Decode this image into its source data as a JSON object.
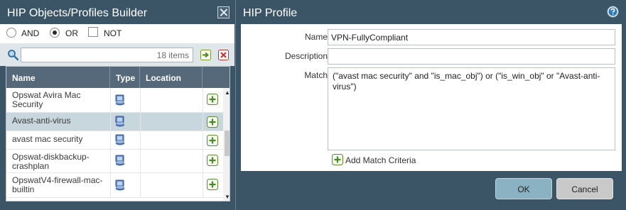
{
  "left_panel": {
    "title": "HIP Objects/Profiles Builder",
    "logic": {
      "and_label": "AND",
      "or_label": "OR",
      "not_label": "NOT",
      "selected": "OR"
    },
    "search": {
      "value": "",
      "count_text": "18 items"
    },
    "columns": [
      "Name",
      "Type",
      "Location"
    ],
    "rows": [
      {
        "name": "Opswat Avira Mac Security",
        "type_icon": "hip-object-icon",
        "location": ""
      },
      {
        "name": "Avast-anti-virus",
        "type_icon": "hip-object-icon",
        "location": "",
        "selected": true
      },
      {
        "name": "avast mac security",
        "type_icon": "hip-object-icon",
        "location": ""
      },
      {
        "name": "Opswat-diskbackup-crashplan",
        "type_icon": "hip-object-icon",
        "location": ""
      },
      {
        "name": "OpswatV4-firewall-mac-builtin",
        "type_icon": "hip-object-icon",
        "location": ""
      }
    ]
  },
  "dialog": {
    "title": "HIP Profile",
    "fields": {
      "name_label": "Name",
      "name_value": "VPN-FullyCompliant",
      "description_label": "Description",
      "description_value": "",
      "match_label": "Match",
      "match_value": "(\"avast mac security\" and \"is_mac_obj\") or (\"is_win_obj\"  or \"Avast-anti-virus\")"
    },
    "add_match_label": "Add Match Criteria",
    "ok_label": "OK",
    "cancel_label": "Cancel"
  },
  "colors": {
    "panel_bg": "#3b5567",
    "header_bg": "#56697a",
    "selected_row": "#c8d6de",
    "ok_button": "#8ab2c3",
    "cancel_button": "#c9c9c9",
    "add_icon_green": "#4b8a2b"
  }
}
